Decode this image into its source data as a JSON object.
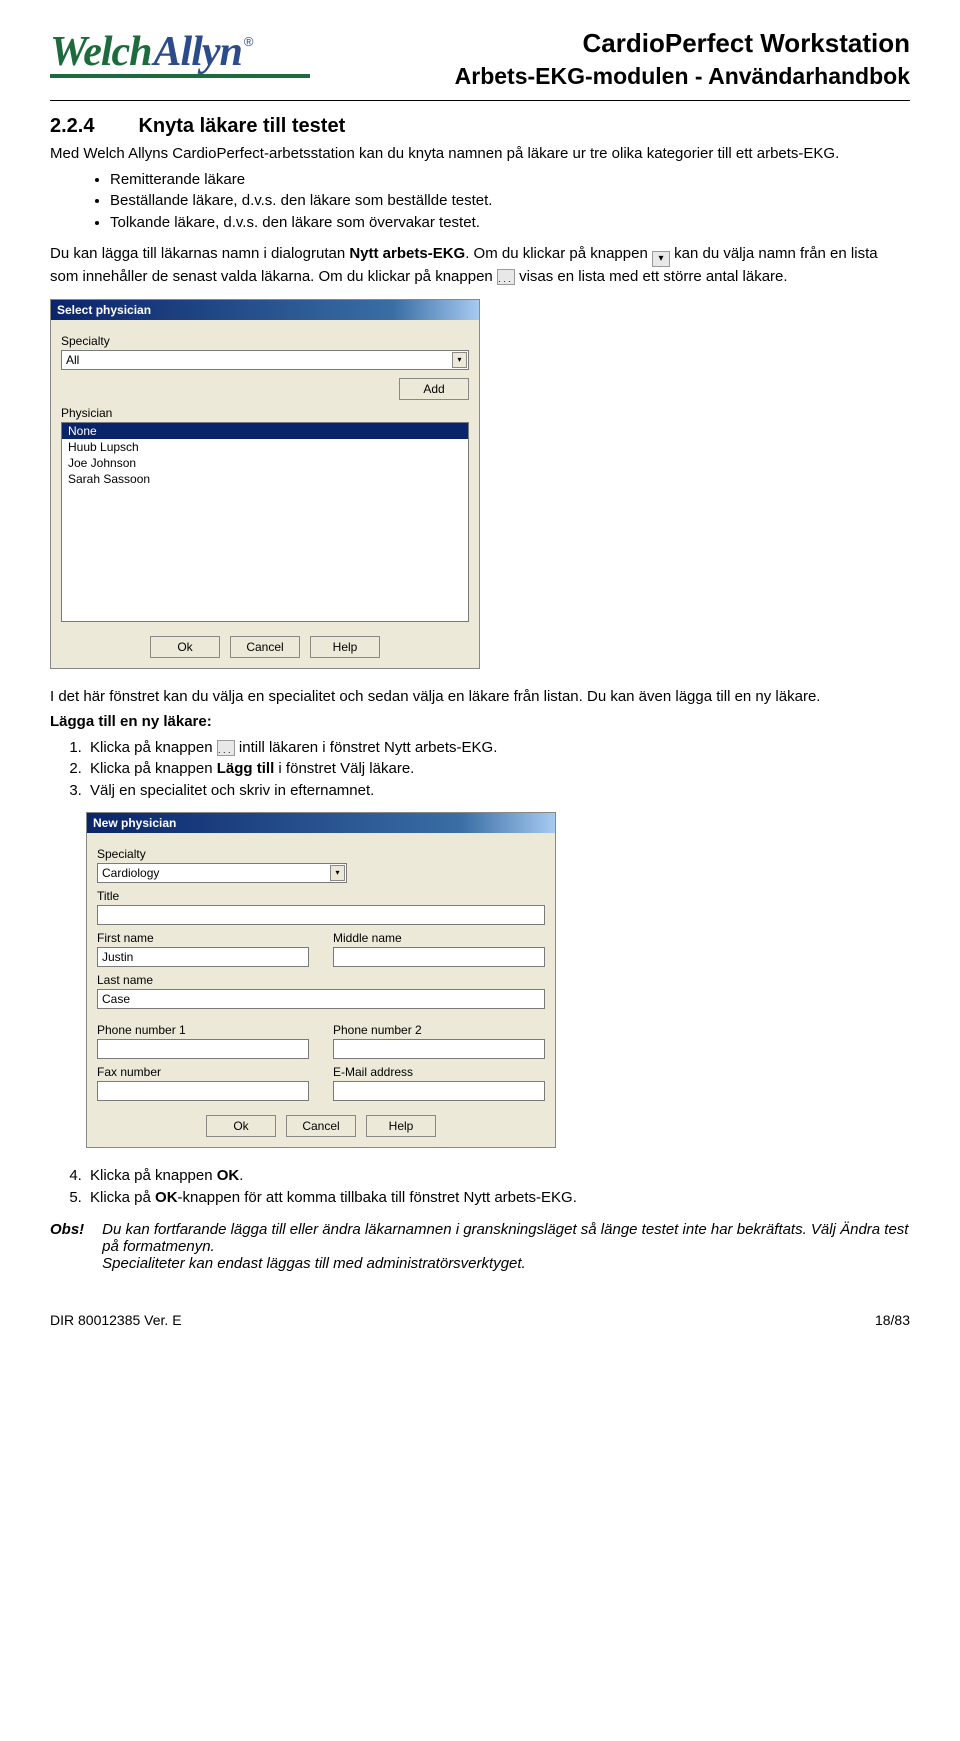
{
  "header": {
    "logo_part1": "Welch",
    "logo_part2": "Allyn",
    "logo_reg": "®",
    "title1": "CardioPerfect Workstation",
    "title2": "Arbets-EKG-modulen - Användarhandbok"
  },
  "section": {
    "number": "2.2.4",
    "title": "Knyta läkare till testet",
    "intro": "Med Welch Allyns CardioPerfect-arbetsstation kan du knyta namnen på läkare ur tre olika kategorier till ett arbets-EKG.",
    "bullets": [
      "Remitterande läkare",
      "Beställande läkare, d.v.s. den läkare som beställde testet.",
      "Tolkande läkare, d.v.s. den läkare som övervakar testet."
    ],
    "para2a": "Du kan lägga till läkarnas namn i dialogrutan ",
    "para2b": "Nytt arbets-EKG",
    "para2c": ". Om du klickar på knappen ",
    "para2d": " kan du välja namn från en lista som innehåller de senast valda läkarna. Om du klickar på knappen ",
    "para2e": " visas en lista med ett större antal läkare."
  },
  "dialog1": {
    "title": "Select physician",
    "label_specialty": "Specialty",
    "specialty_value": "All",
    "label_physician": "Physician",
    "add": "Add",
    "items": [
      "None",
      "Huub Lupsch",
      "Joe Johnson",
      "Sarah Sassoon"
    ],
    "ok": "Ok",
    "cancel": "Cancel",
    "help": "Help"
  },
  "midtext": {
    "p1": "I det här fönstret kan du välja en specialitet och sedan välja en läkare från listan. Du kan även lägga till en ny läkare.",
    "heading": "Lägga till en ny läkare:",
    "step1a": "Klicka på knappen ",
    "step1b": " intill läkaren i fönstret Nytt arbets-EKG.",
    "step2a": "Klicka på knappen ",
    "step2b": "Lägg till",
    "step2c": " i fönstret Välj läkare.",
    "step3": "Välj en specialitet och skriv in efternamnet."
  },
  "dialog2": {
    "title": "New physician",
    "label_specialty": "Specialty",
    "specialty_value": "Cardiology",
    "label_title": "Title",
    "label_first": "First name",
    "first_value": "Justin",
    "label_middle": "Middle name",
    "label_last": "Last name",
    "last_value": "Case",
    "label_phone1": "Phone number 1",
    "label_phone2": "Phone number 2",
    "label_fax": "Fax number",
    "label_email": "E-Mail address",
    "ok": "Ok",
    "cancel": "Cancel",
    "help": "Help"
  },
  "steps_after": {
    "step4a": "Klicka på knappen ",
    "step4b": "OK",
    "step4c": ".",
    "step5a": "Klicka på ",
    "step5b": "OK",
    "step5c": "-knappen för att komma tillbaka till fönstret Nytt arbets-EKG."
  },
  "obs": {
    "label": "Obs!",
    "line1a": "Du kan fortfarande lägga till eller ändra läkarnamnen i granskningsläget så länge testet inte har bekräftats. ",
    "line1b": "Välj Ändra test på formatmenyn.",
    "line2": "Specialiteter kan endast läggas till med administratörsverktyget."
  },
  "footer": {
    "left": "DIR 80012385 Ver. E",
    "right": "18/83"
  }
}
